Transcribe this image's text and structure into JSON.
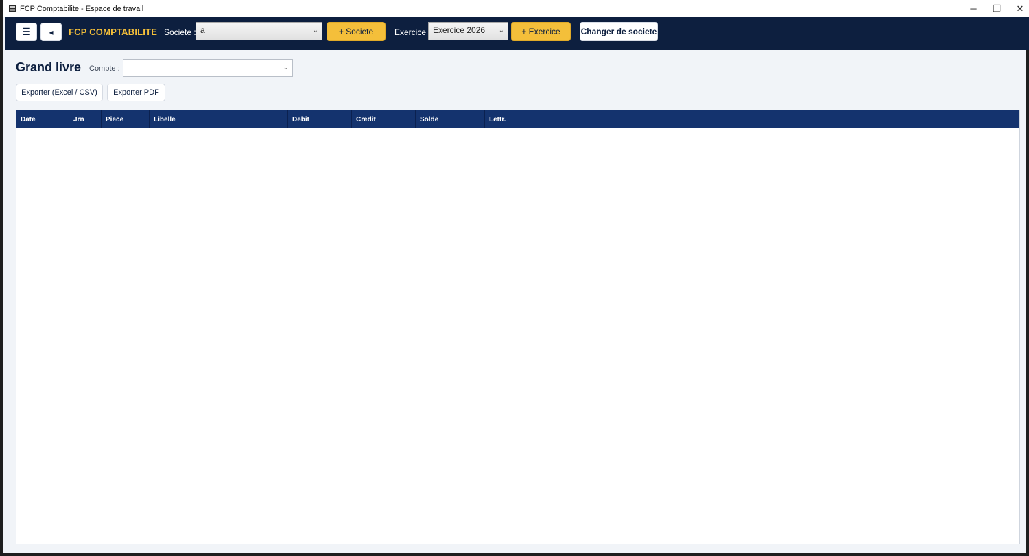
{
  "window": {
    "title": "FCP Comptabilite - Espace de travail",
    "minimize_glyph": "─",
    "restore_glyph": "❐",
    "close_glyph": "✕"
  },
  "header": {
    "menu_glyph": "☰",
    "back_glyph": "◂",
    "brand": "FCP COMPTABILITE",
    "societe_label": "Societe :",
    "societe_value": "a",
    "add_societe": "+ Societe",
    "exercice_label": "Exercice :",
    "exercice_value": "Exercice 2026",
    "add_exercice": "+ Exercice",
    "change_societe": "Changer de societe",
    "chevron": "⌄"
  },
  "page": {
    "title": "Grand livre",
    "compte_label": "Compte :",
    "compte_value": "",
    "export_excel": "Exporter (Excel / CSV)",
    "export_pdf": "Exporter PDF"
  },
  "table": {
    "columns": [
      "Date",
      "Jrn",
      "Piece",
      "Libelle",
      "Debit",
      "Credit",
      "Solde",
      "Lettr."
    ],
    "rows": []
  },
  "colors": {
    "header_bg": "#0d1f3f",
    "accent": "#f4bf3a",
    "table_header": "#14336e",
    "page_bg": "#f1f4f8"
  },
  "icons": {
    "menu": "hamburger-icon",
    "back": "back-arrow-icon",
    "app": "app-icon",
    "chevron": "chevron-down-icon"
  }
}
